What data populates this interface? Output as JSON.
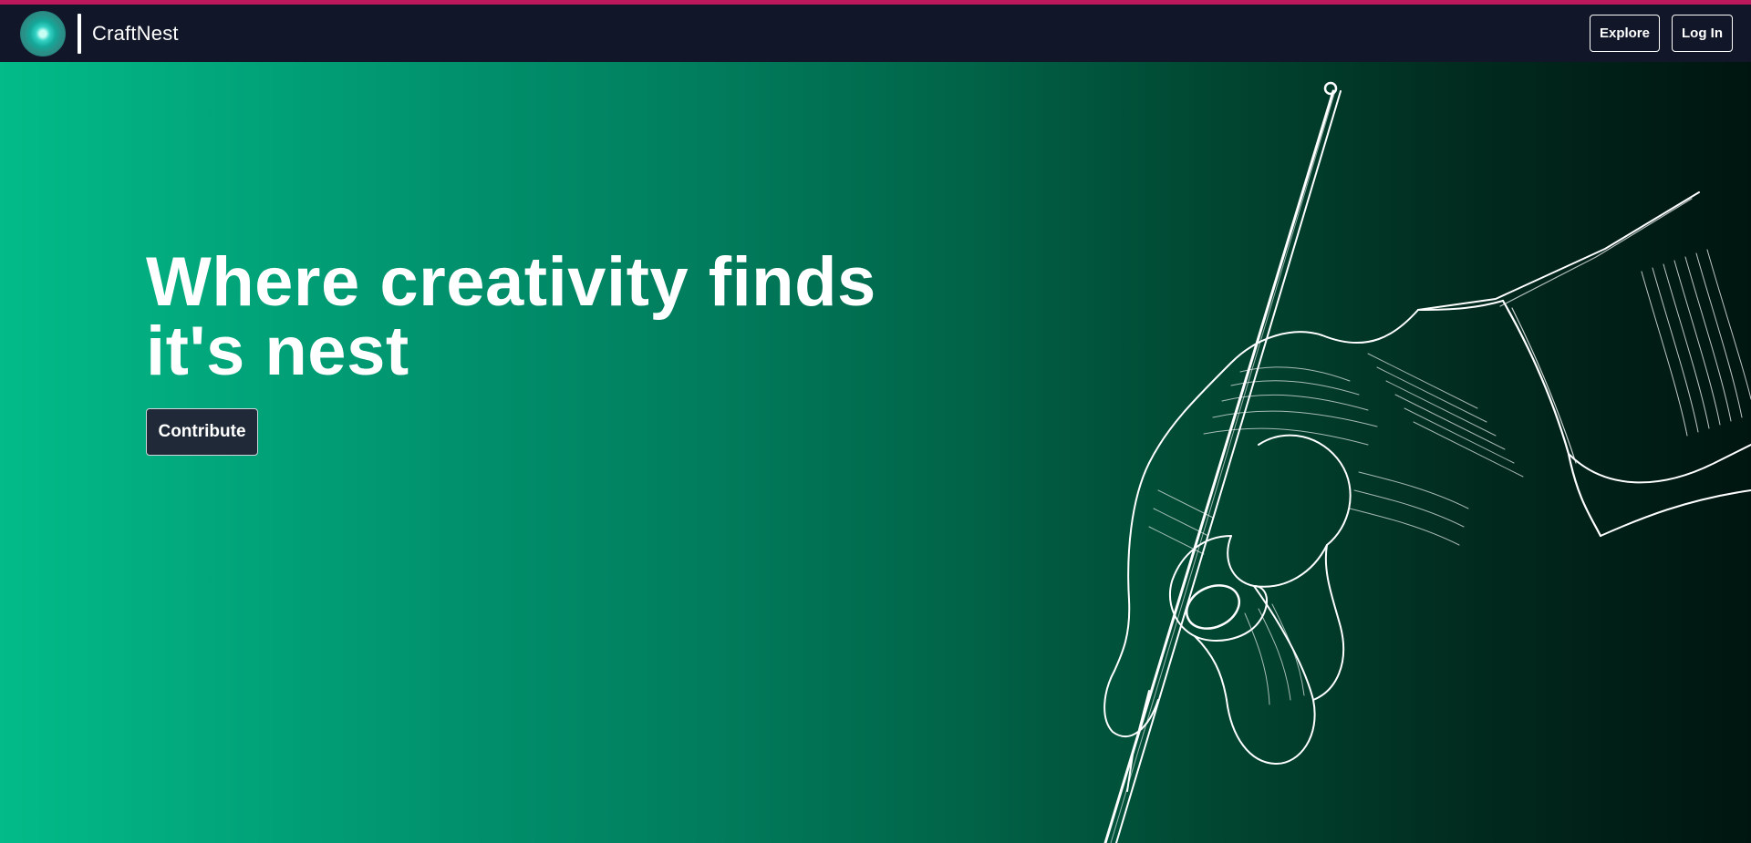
{
  "app": {
    "brand_name": "CraftNest"
  },
  "nav": {
    "explore_label": "Explore",
    "login_label": "Log In"
  },
  "hero": {
    "title_line1": "Where creativity finds",
    "title_line2": "it's nest",
    "contribute_label": "Contribute"
  },
  "icons": {
    "logo": "target-circle-logo-icon",
    "illustration": "hand-holding-pen-illustration"
  },
  "colors": {
    "top_strip": "#be185d",
    "navbar": "#111729",
    "hero_gradient_start": "#02bb88",
    "hero_gradient_end": "#001510",
    "button_dark": "#1f2937",
    "text": "#ffffff"
  }
}
